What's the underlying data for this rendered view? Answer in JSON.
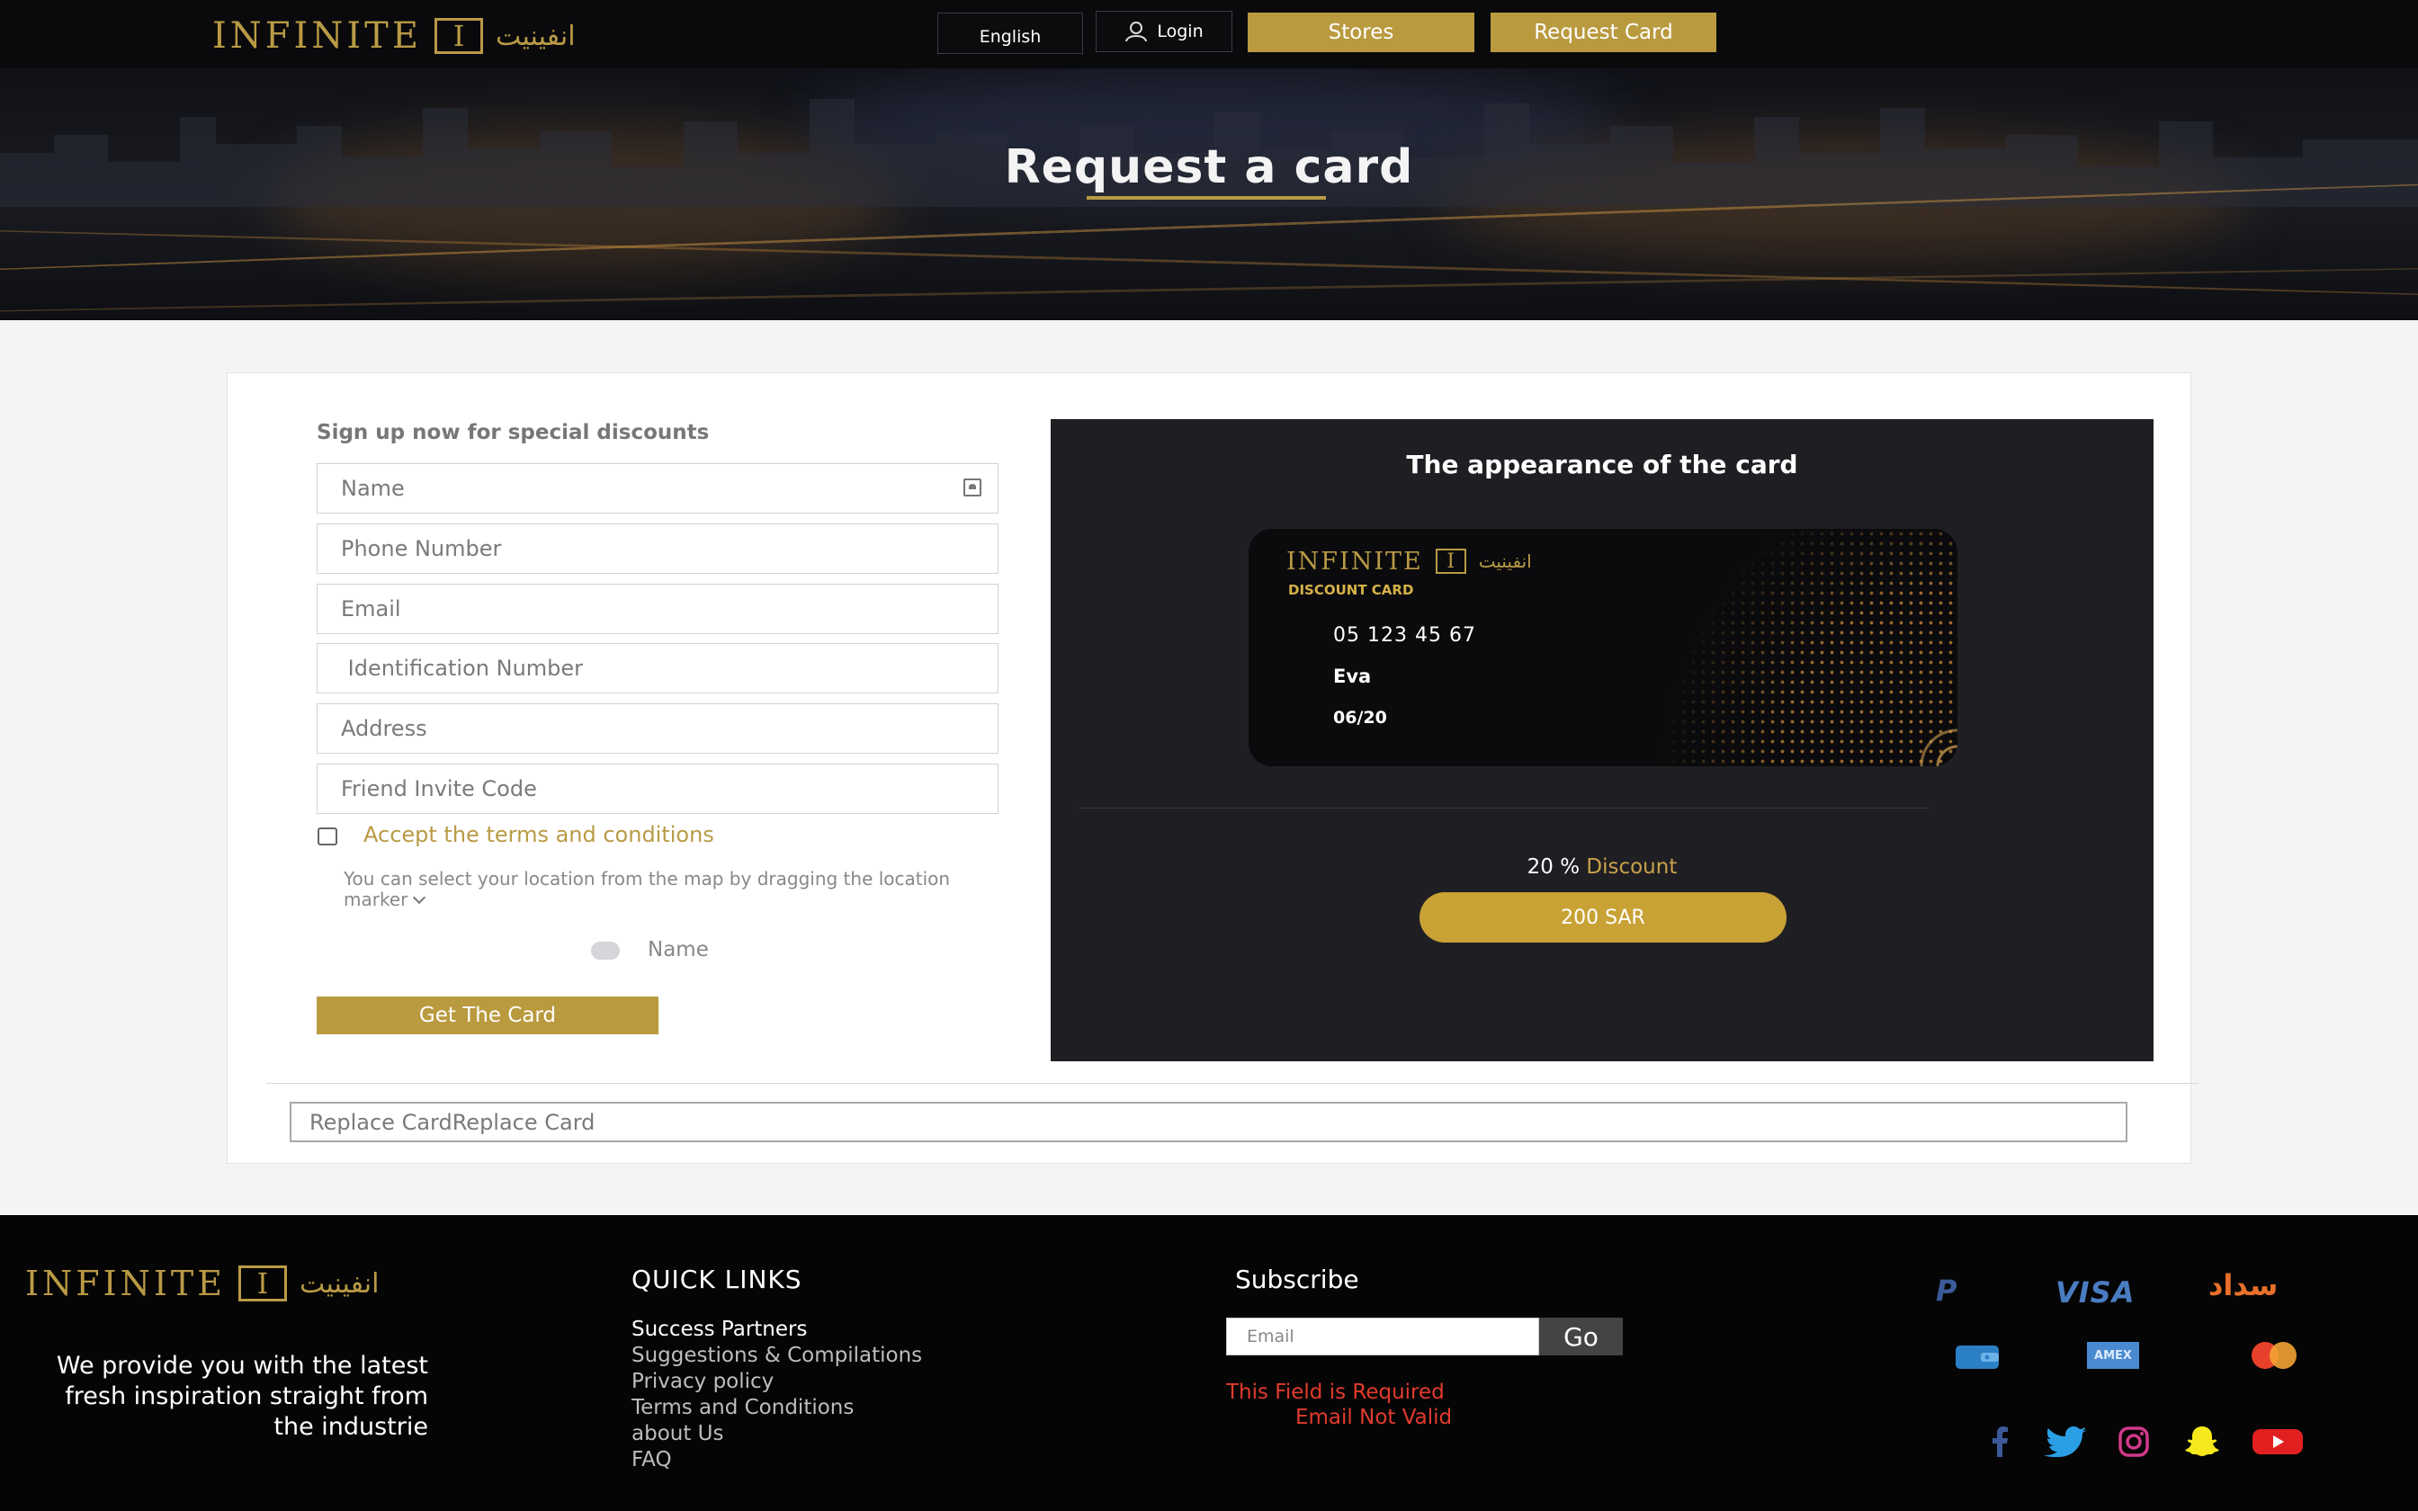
{
  "header": {
    "logo_text": "INFINITE",
    "logo_mark": "I",
    "logo_arabic": "انفينيت",
    "language": "English",
    "login": "Login",
    "stores": "Stores",
    "request_card": "Request Card"
  },
  "hero": {
    "title": "Request a card"
  },
  "form": {
    "heading": "Sign up now for special discounts",
    "fields": [
      {
        "placeholder": "Name"
      },
      {
        "placeholder": "Phone Number"
      },
      {
        "placeholder": "Email"
      },
      {
        "placeholder": " Identification Number"
      },
      {
        "placeholder": "Address"
      },
      {
        "placeholder": "Friend Invite Code"
      }
    ],
    "terms": "Accept the terms and conditions",
    "map_hint": "You can select your location from the map by dragging the location marker",
    "radio_label": "Name",
    "submit": "Get The Card",
    "replace": "Replace CardReplace Card"
  },
  "preview": {
    "title": "The appearance of the card",
    "card_logo": "INFINITE",
    "card_logo_mark": "I",
    "card_logo_arabic": "انفينيت",
    "card_label": "DISCOUNT CARD",
    "card_number": "05 123 45 67",
    "card_name": "Eva",
    "card_expiry": "06/20",
    "discount_value": "20 %",
    "discount_word": "Discount",
    "price": "200 SAR"
  },
  "footer": {
    "logo_text": "INFINITE",
    "logo_mark": "I",
    "logo_arabic": "انفينيت",
    "tagline": "We provide you with the latest fresh inspiration straight from the industrie",
    "quick_links_title": "QUICK LINKS",
    "quick_links": [
      "Success Partners",
      "Suggestions & Compilations",
      "Privacy policy",
      "Terms and Conditions",
      "about Us",
      "FAQ"
    ],
    "subscribe_title": "Subscribe",
    "subscribe_placeholder": "Email",
    "subscribe_go": "Go",
    "error_required": "This Field is Required",
    "error_invalid": "Email Not Valid",
    "payments": {
      "paypal": "P",
      "visa": "VISA",
      "sadad": "سداد",
      "amex": "AMEX"
    }
  },
  "colors": {
    "gold": "#b99a3f",
    "dark": "#050505",
    "error": "#e23b2e"
  }
}
